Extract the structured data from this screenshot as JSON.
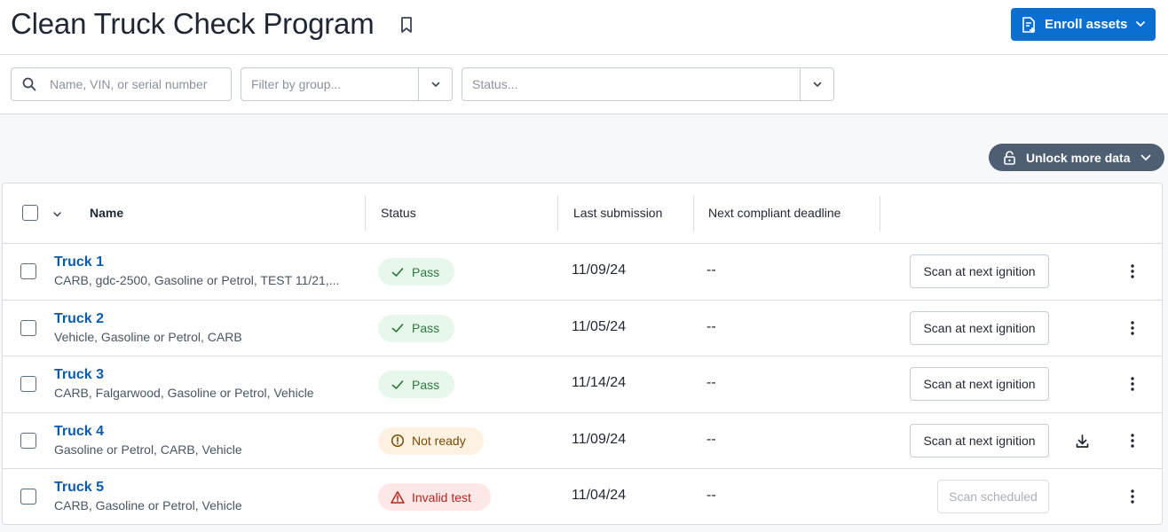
{
  "header": {
    "title": "Clean Truck Check Program",
    "enroll_label": "Enroll assets"
  },
  "filters": {
    "search_placeholder": "Name, VIN, or serial number",
    "group_placeholder": "Filter by group...",
    "status_placeholder": "Status..."
  },
  "unlock_label": "Unlock more data",
  "table": {
    "columns": {
      "name": "Name",
      "status": "Status",
      "last_submission": "Last submission",
      "next_deadline": "Next compliant deadline"
    },
    "rows": [
      {
        "name": "Truck 1",
        "desc": "CARB, gdc-2500, Gasoline or Petrol, TEST 11/21,...",
        "status": "Pass",
        "status_type": "pass",
        "date": "11/09/24",
        "deadline": "--",
        "action": "Scan at next ignition",
        "action_disabled": false,
        "download": false
      },
      {
        "name": "Truck 2",
        "desc": "Vehicle, Gasoline or Petrol, CARB",
        "status": "Pass",
        "status_type": "pass",
        "date": "11/05/24",
        "deadline": "--",
        "action": "Scan at next ignition",
        "action_disabled": false,
        "download": false
      },
      {
        "name": "Truck 3",
        "desc": "CARB, Falgarwood, Gasoline or Petrol, Vehicle",
        "status": "Pass",
        "status_type": "pass",
        "date": "11/14/24",
        "deadline": "--",
        "action": "Scan at next ignition",
        "action_disabled": false,
        "download": false
      },
      {
        "name": "Truck 4",
        "desc": "Gasoline or Petrol, CARB, Vehicle",
        "status": "Not ready",
        "status_type": "notready",
        "date": "11/09/24",
        "deadline": "--",
        "action": "Scan at next ignition",
        "action_disabled": false,
        "download": true
      },
      {
        "name": "Truck 5",
        "desc": "CARB, Gasoline or Petrol, Vehicle",
        "status": "Invalid test",
        "status_type": "invalid",
        "date": "11/04/24",
        "deadline": "--",
        "action": "Scan scheduled",
        "action_disabled": true,
        "download": false
      }
    ]
  },
  "colors": {
    "primary": "#0b6fd1",
    "link": "#0b5cad",
    "unlock_bg": "#4e5f73",
    "pass_bg": "#e8f7ec",
    "notready_bg": "#fdf1e2",
    "invalid_bg": "#fde7e7"
  },
  "icons": {
    "bookmark": "bookmark-icon",
    "enroll": "document-add-icon",
    "search": "search-icon",
    "chevron": "chevron-down-icon",
    "lock": "lock-icon",
    "pass": "check-icon",
    "notready": "warning-circle-icon",
    "invalid": "warning-triangle-icon",
    "download": "download-icon",
    "more": "more-vertical-icon"
  }
}
